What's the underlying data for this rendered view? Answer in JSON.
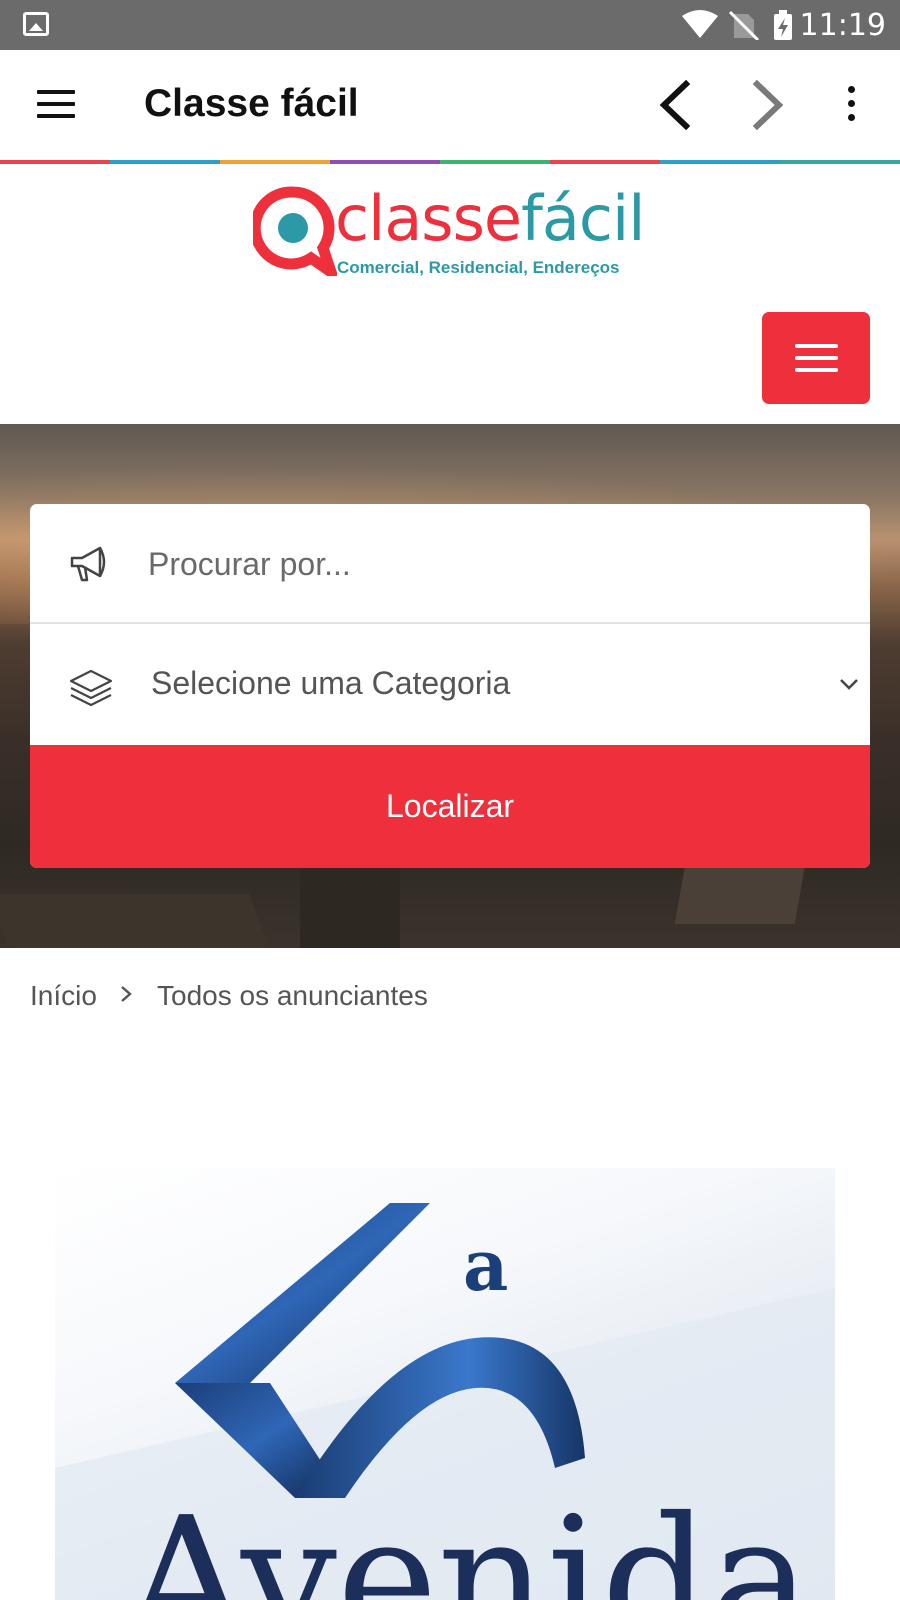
{
  "status_bar": {
    "time": "11:19",
    "icons": [
      "gallery-icon",
      "wifi-icon",
      "no-sim-icon",
      "battery-charging-icon"
    ]
  },
  "app_bar": {
    "title": "Classe fácil",
    "icons": [
      "menu-icon",
      "back-arrow-icon",
      "forward-arrow-icon",
      "overflow-menu-icon"
    ]
  },
  "site": {
    "logo_word_1": "classe",
    "logo_word_2": "fácil",
    "logo_tagline": "Comercial, Residencial, Endereços",
    "colors": {
      "brand_red": "#ee2f3c",
      "brand_teal": "#2b9aa6"
    }
  },
  "search": {
    "placeholder": "Procurar por...",
    "category_placeholder": "Selecione uma Categoria",
    "submit_label": "Localizar"
  },
  "breadcrumb": {
    "home": "Início",
    "current": "Todos os anunciantes"
  },
  "advertiser": {
    "logo_text": "Avenida",
    "logo_superscript": "a"
  }
}
